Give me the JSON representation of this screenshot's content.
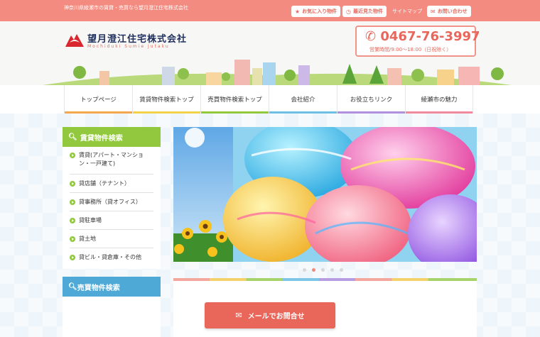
{
  "topbar": {
    "tagline": "神奈川県綾瀬市の賃貸・売買なら望月澄江住宅株式会社",
    "favorites_label": "お気に入り物件",
    "recent_label": "最近見た物件",
    "sitemap_label": "サイトマップ",
    "contact_label": "お問い合わせ"
  },
  "header": {
    "company_name": "望月澄江住宅株式会社",
    "company_romaji": "Mochiduki Sumie Jutaku",
    "phone": "0467-76-3997",
    "hours": "営業時間/9:00～18:00（日祝除く）"
  },
  "nav": {
    "items": [
      {
        "label": "トップページ",
        "color": "#f4a74d"
      },
      {
        "label": "賃貸物件検索トップ",
        "color": "#f3d34a"
      },
      {
        "label": "売買物件検索トップ",
        "color": "#92c83e"
      },
      {
        "label": "会社紹介",
        "color": "#6ec1e4"
      },
      {
        "label": "お役立ちリンク",
        "color": "#b08fdc"
      },
      {
        "label": "綾瀬市の魅力",
        "color": "#f08a9c"
      }
    ]
  },
  "rental_search": {
    "title": "賃貸物件検索",
    "items": [
      {
        "label": "賃貸(アパート・マンション・一戸建て)"
      },
      {
        "label": "貸店舗（テナント）"
      },
      {
        "label": "貸事務所（貸オフィス）"
      },
      {
        "label": "貸駐車場"
      },
      {
        "label": "貸土地"
      },
      {
        "label": "貸ビル・貸倉庫・その他"
      }
    ]
  },
  "sales_search": {
    "title": "売買物件検索"
  },
  "slider": {
    "slide_count": 5,
    "active_index": 1
  },
  "footer_cta": {
    "mail_label": "メールでお問合せ"
  },
  "colors": {
    "brand": "#f48b80",
    "phone": "#e8665a",
    "rental_head": "#92c83e",
    "sales_head": "#4fa9d6"
  }
}
